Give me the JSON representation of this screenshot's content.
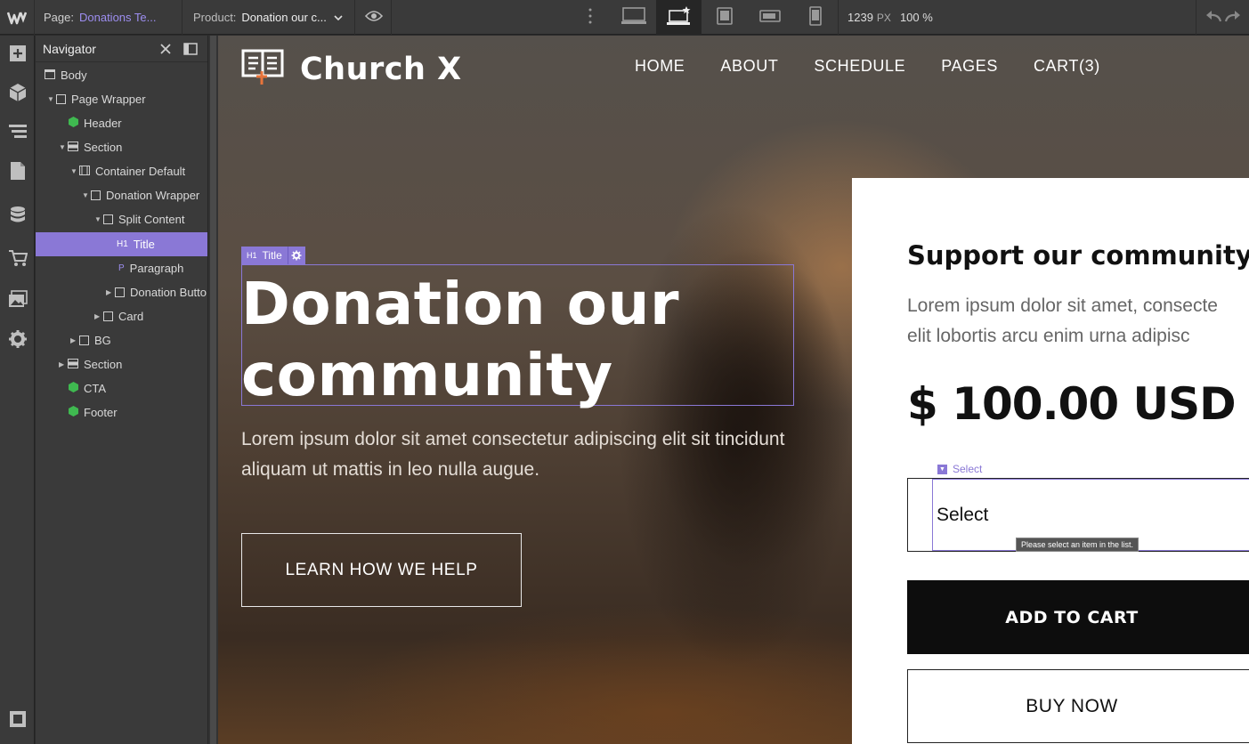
{
  "topbar": {
    "page_label": "Page:",
    "page_value": "Donations Te...",
    "product_label": "Product:",
    "product_value": "Donation our c...",
    "width_value": "1239",
    "width_unit": "PX",
    "zoom": "100 %"
  },
  "navigator": {
    "title": "Navigator",
    "items": [
      {
        "label": "Body",
        "depth": 0
      },
      {
        "label": "Page Wrapper",
        "depth": 1
      },
      {
        "label": "Header",
        "depth": 2
      },
      {
        "label": "Section",
        "depth": 2
      },
      {
        "label": "Container Default",
        "depth": 3
      },
      {
        "label": "Donation Wrapper",
        "depth": 4
      },
      {
        "label": "Split Content",
        "depth": 5
      },
      {
        "label": "Title",
        "depth": 6,
        "tag": "H1"
      },
      {
        "label": "Paragraph",
        "depth": 6,
        "tag": "P"
      },
      {
        "label": "Donation Butto",
        "depth": 6
      },
      {
        "label": "Card",
        "depth": 5
      },
      {
        "label": "BG",
        "depth": 3
      },
      {
        "label": "Section",
        "depth": 2
      },
      {
        "label": "CTA",
        "depth": 2
      },
      {
        "label": "Footer",
        "depth": 2
      }
    ]
  },
  "site": {
    "brand": "Church X",
    "menu": [
      "HOME",
      "ABOUT",
      "SCHEDULE",
      "PAGES",
      "CART(3)"
    ],
    "selected_tag": "H1",
    "selected_name": "Title",
    "heading_line1": "Donation our",
    "heading_line2": "community",
    "paragraph": "Lorem ipsum dolor sit amet consectetur adipiscing elit sit tincidunt aliquam ut mattis in leo nulla augue.",
    "learn_button": "LEARN HOW WE HELP"
  },
  "card": {
    "title": "Support our community",
    "text_line1": "Lorem ipsum dolor sit amet, consecte",
    "text_line2": "elit lobortis arcu enim urna adipisc",
    "price": "$ 100.00 USD",
    "select_tag": "Select",
    "select_value": "Select",
    "tooltip": "Please select an item in the list.",
    "add_to_cart": "ADD TO CART",
    "buy_now": "BUY NOW"
  },
  "colors": {
    "accent": "#8a78d6",
    "panel": "#3a3a3a",
    "green_symbol": "#3fb950",
    "orange": "#e8743b"
  }
}
